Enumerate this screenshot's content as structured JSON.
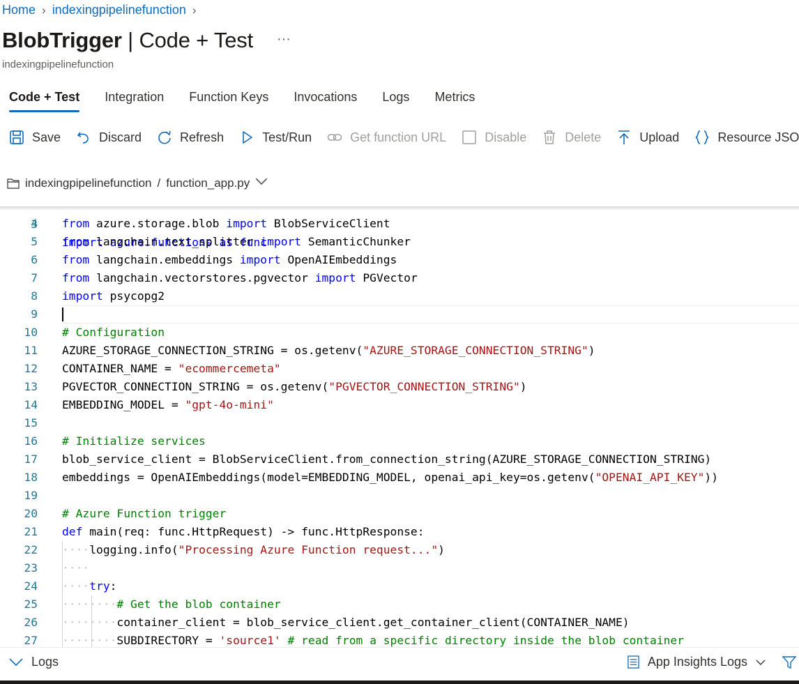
{
  "breadcrumb": {
    "home": "Home",
    "app": "indexingpipelinefunction"
  },
  "header": {
    "title_bold": "BlobTrigger",
    "title_rest": " | Code + Test",
    "more": "···",
    "subtitle": "indexingpipelinefunction"
  },
  "tabs": [
    "Code + Test",
    "Integration",
    "Function Keys",
    "Invocations",
    "Logs",
    "Metrics"
  ],
  "toolbar": {
    "save": "Save",
    "discard": "Discard",
    "refresh": "Refresh",
    "test_run": "Test/Run",
    "get_url": "Get function URL",
    "disable": "Disable",
    "delete": "Delete",
    "upload": "Upload",
    "resource_json": "Resource JSON"
  },
  "path": {
    "folder": "indexingpipelinefunction",
    "sep": "/",
    "file": "function_app.py"
  },
  "editor": {
    "partial_top": "import azure.functions as func",
    "lines": [
      {
        "n": "4",
        "code": "from azure.storage.blob import BlobServiceClient"
      },
      {
        "n": "5",
        "code": "from langchain.text_splitter import SemanticChunker"
      },
      {
        "n": "6",
        "code": "from langchain.embeddings import OpenAIEmbeddings"
      },
      {
        "n": "7",
        "code": "from langchain.vectorstores.pgvector import PGVector"
      },
      {
        "n": "8",
        "code": "import psycopg2"
      },
      {
        "n": "9",
        "code": ""
      },
      {
        "n": "10",
        "code": "# Configuration"
      },
      {
        "n": "11",
        "code": "AZURE_STORAGE_CONNECTION_STRING = os.getenv(\"AZURE_STORAGE_CONNECTION_STRING\")"
      },
      {
        "n": "12",
        "code": "CONTAINER_NAME = \"ecommercemeta\""
      },
      {
        "n": "13",
        "code": "PGVECTOR_CONNECTION_STRING = os.getenv(\"PGVECTOR_CONNECTION_STRING\")"
      },
      {
        "n": "14",
        "code": "EMBEDDING_MODEL = \"gpt-4o-mini\""
      },
      {
        "n": "15",
        "code": ""
      },
      {
        "n": "16",
        "code": "# Initialize services"
      },
      {
        "n": "17",
        "code": "blob_service_client = BlobServiceClient.from_connection_string(AZURE_STORAGE_CONNECTION_STRING)"
      },
      {
        "n": "18",
        "code": "embeddings = OpenAIEmbeddings(model=EMBEDDING_MODEL, openai_api_key=os.getenv(\"OPENAI_API_KEY\"))"
      },
      {
        "n": "19",
        "code": ""
      },
      {
        "n": "20",
        "code": "# Azure Function trigger"
      },
      {
        "n": "21",
        "code": "def main(req: func.HttpRequest) -> func.HttpResponse:"
      },
      {
        "n": "22",
        "code": "    logging.info(\"Processing Azure Function request...\")"
      },
      {
        "n": "23",
        "code": "    "
      },
      {
        "n": "24",
        "code": "    try:"
      },
      {
        "n": "25",
        "code": "        # Get the blob container"
      },
      {
        "n": "26",
        "code": "        container_client = blob_service_client.get_container_client(CONTAINER_NAME)"
      },
      {
        "n": "27",
        "code": "        SUBDIRECTORY = 'source1' # read from a specific directory inside the blob container"
      }
    ]
  },
  "bottom": {
    "logs": "Logs",
    "insights": "App Insights Logs"
  }
}
